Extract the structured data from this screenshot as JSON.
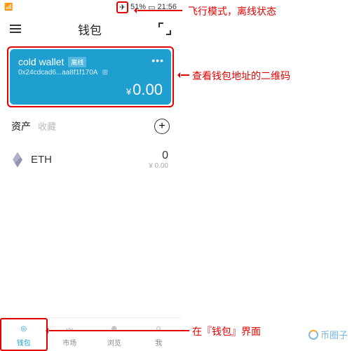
{
  "status_bar": {
    "battery_pct": "51%",
    "time": "21:56"
  },
  "header": {
    "title": "钱包"
  },
  "wallet_card": {
    "name": "cold wallet",
    "tag": "离线",
    "address": "0x24cdcad6...aa8f1f170A",
    "currency": "¥",
    "balance": "0.00"
  },
  "assets": {
    "tab_assets": "资产",
    "tab_collectibles": "收藏",
    "items": [
      {
        "symbol": "ETH",
        "amount": "0",
        "fiat": "¥ 0.00"
      }
    ]
  },
  "bottom_nav": {
    "wallet": "钱包",
    "market": "市场",
    "browse": "浏览",
    "me": "我"
  },
  "annotations": {
    "airplane": "飞行模式，离线状态",
    "qrcode": "查看钱包地址的二维码",
    "wallet_tab": "在『钱包』界面"
  },
  "watermark": "币圈子"
}
